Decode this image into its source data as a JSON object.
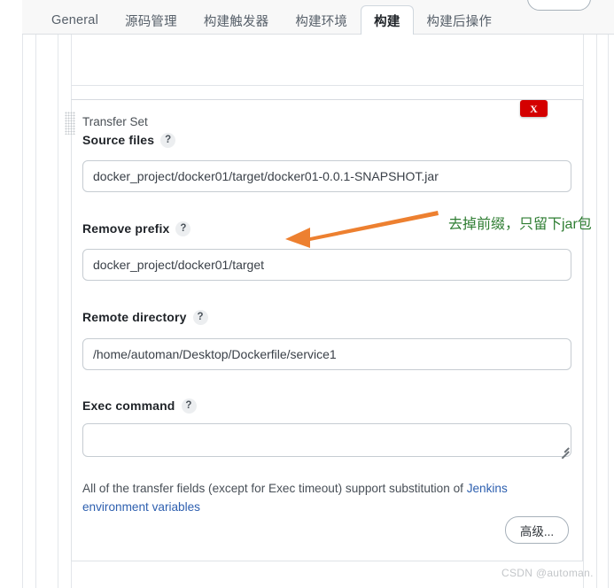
{
  "tabs": [
    {
      "label": "General",
      "active": false
    },
    {
      "label": "源码管理",
      "active": false
    },
    {
      "label": "构建触发器",
      "active": false
    },
    {
      "label": "构建环境",
      "active": false
    },
    {
      "label": "构建",
      "active": true
    },
    {
      "label": "构建后操作",
      "active": false
    }
  ],
  "transfer_set": {
    "title": "Transfer Set",
    "delete_label": "X",
    "help_glyph": "?",
    "fields": [
      {
        "label": "Source files",
        "value": "docker_project/docker01/target/docker01-0.0.1-SNAPSHOT.jar",
        "placeholder": ""
      },
      {
        "label": "Remove prefix",
        "value": "docker_project/docker01/target",
        "placeholder": ""
      },
      {
        "label": "Remote directory",
        "value": "/home/automan/Desktop/Dockerfile/service1",
        "placeholder": ""
      },
      {
        "label": "Exec command",
        "value": "",
        "placeholder": ""
      }
    ],
    "note_prefix": "All of the transfer fields (except for Exec timeout) support substitution of ",
    "note_link": "Jenkins environment variables",
    "advanced_button": "高级..."
  },
  "annotations": {
    "green_note": "去掉前缀，只留下jar包",
    "green_color": "#2e7d32",
    "arrow_color": "#ed8030"
  },
  "watermark": "CSDN @automan.",
  "colors": {
    "tab_active_text": "#1f2328",
    "tab_inactive_text": "#57606a",
    "delete_button": "#d40000",
    "link": "#2d5faf",
    "input_border": "#c6ccd2"
  }
}
